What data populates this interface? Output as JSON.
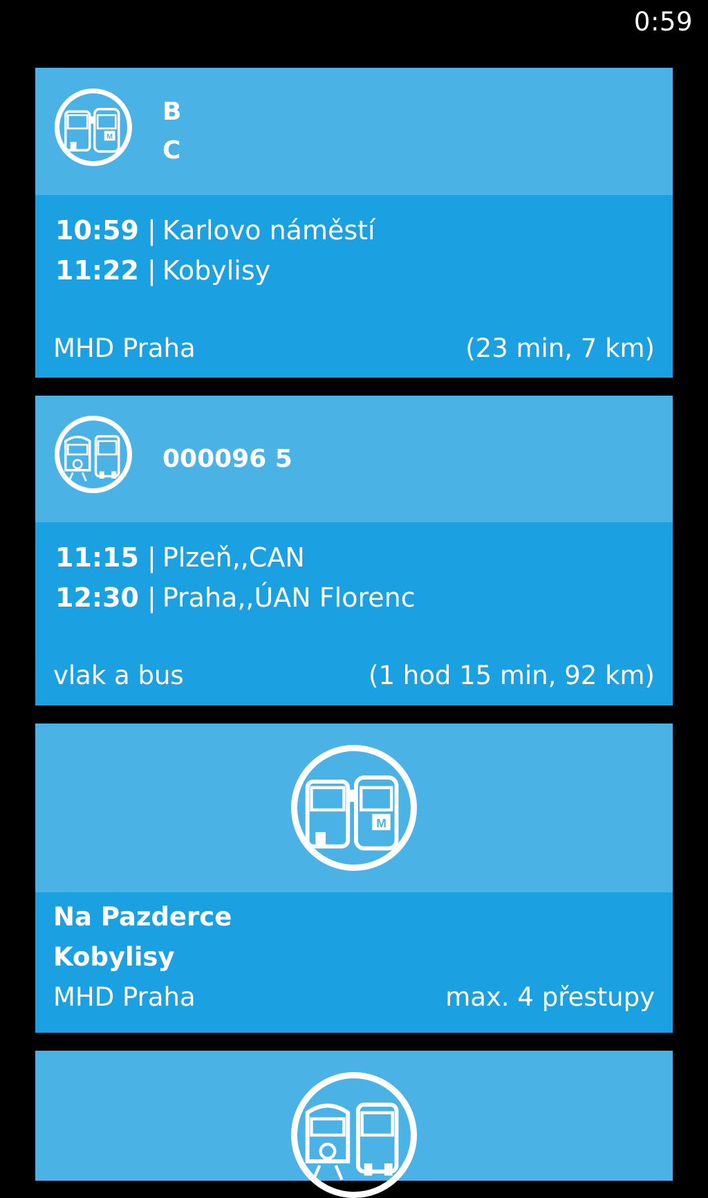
{
  "status_bar": {
    "time": "0:59"
  },
  "connections": [
    {
      "lines": [
        "B",
        "C"
      ],
      "stops": [
        {
          "time": "10:59",
          "name": "Karlovo náměstí"
        },
        {
          "time": "11:22",
          "name": "Kobylisy"
        }
      ],
      "provider": "MHD Praha",
      "summary": "(23 min, 7 km)"
    },
    {
      "lines": [
        "000096 5"
      ],
      "stops": [
        {
          "time": "11:15",
          "name": "Plzeň,,CAN"
        },
        {
          "time": "12:30",
          "name": "Praha,,ÚAN Florenc"
        }
      ],
      "provider": "vlak a bus",
      "summary": "(1 hod 15 min, 92 km)"
    }
  ],
  "search_tile": {
    "from": "Na Pazderce",
    "to": "Kobylisy",
    "provider": "MHD Praha",
    "transfers": "max. 4 přestupy"
  },
  "icons": {
    "city_transport": "bus-metro-icon",
    "train_bus": "train-bus-icon"
  },
  "colors": {
    "tile_light": "#4bb2e6",
    "tile_dark": "#1ba0e1",
    "background": "#000000",
    "text": "#ffffff"
  }
}
